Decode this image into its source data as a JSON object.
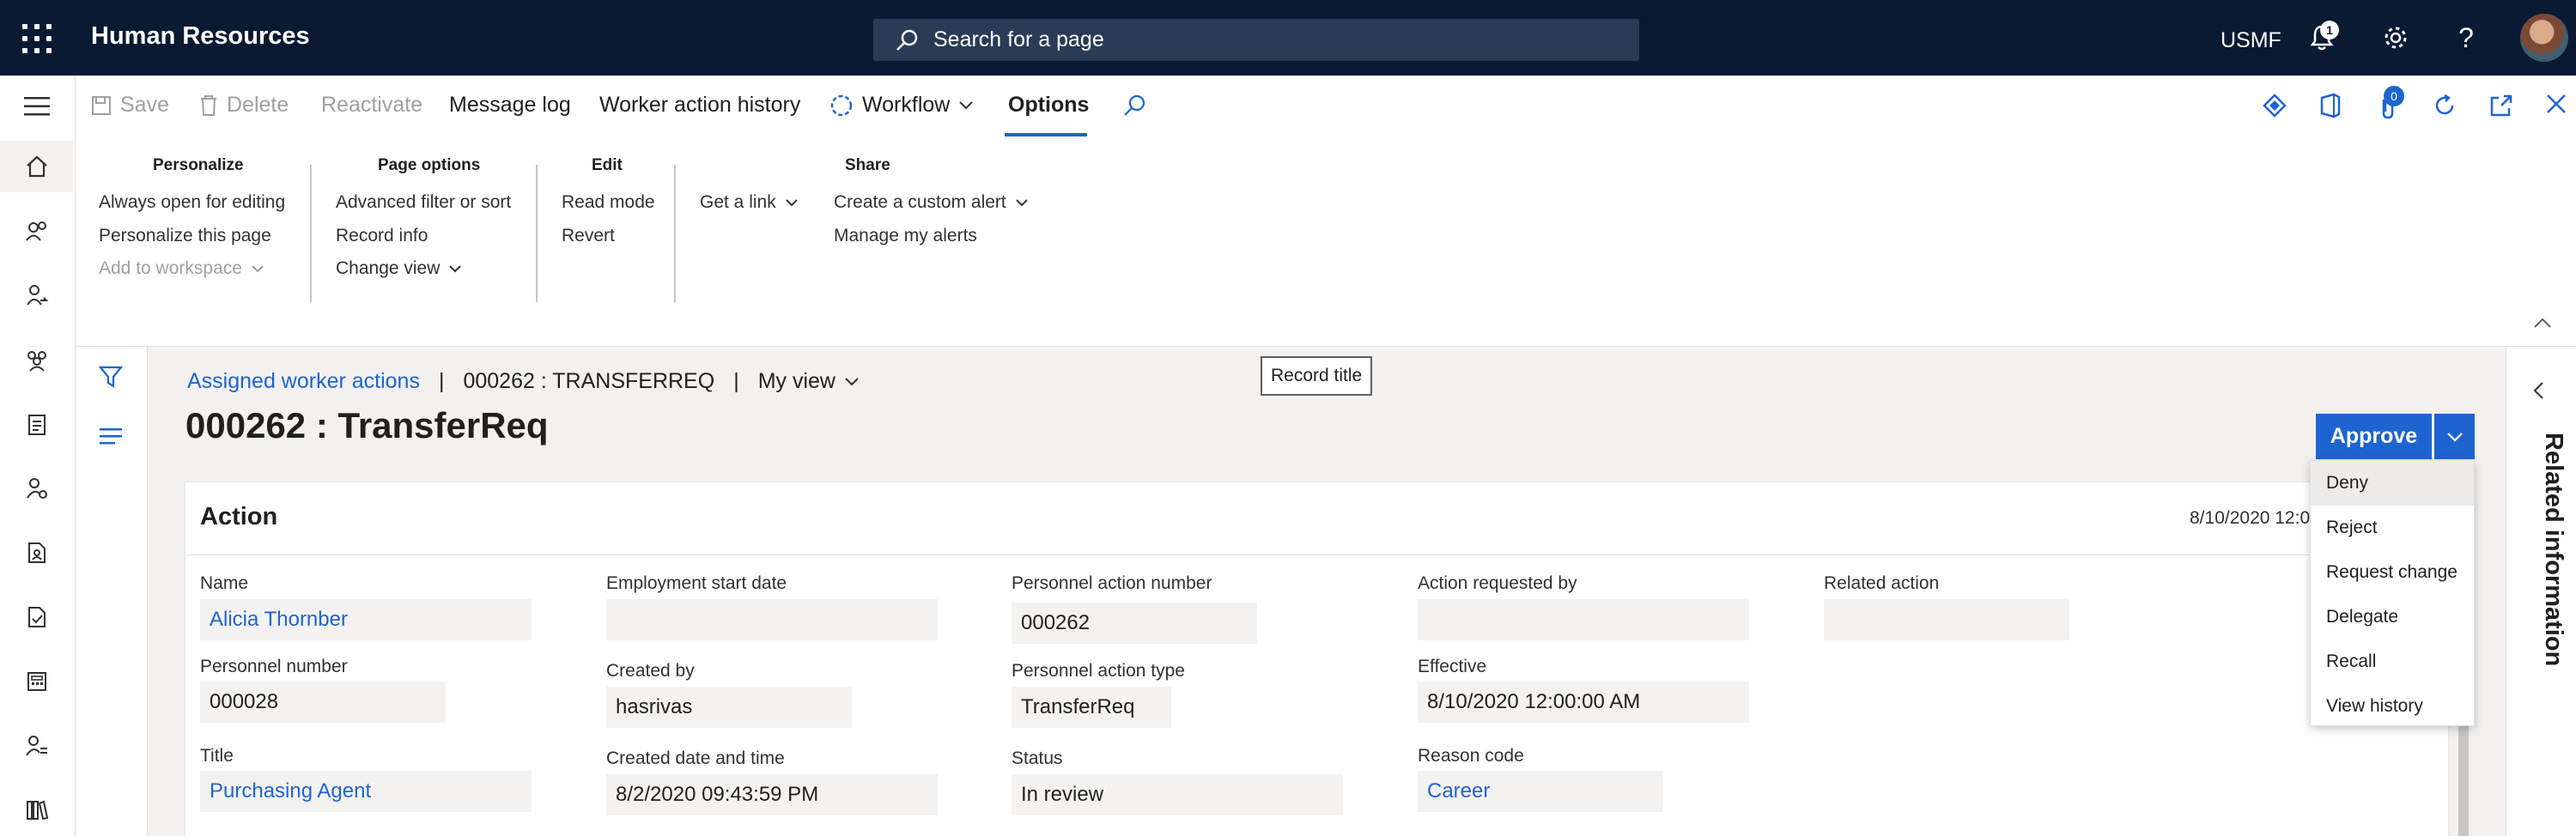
{
  "app": {
    "title": "Human Resources",
    "company": "USMF",
    "notifications": "1"
  },
  "search": {
    "placeholder": "Search for a page"
  },
  "action_pane": {
    "save": "Save",
    "delete": "Delete",
    "reactivate": "Reactivate",
    "message_log": "Message log",
    "worker_action_history": "Worker action history",
    "workflow": "Workflow",
    "options": "Options",
    "attachments_count": "0"
  },
  "ribbon": {
    "groups": [
      {
        "title": "Personalize",
        "items": [
          "Always open for editing",
          "Personalize this page",
          "Add to workspace"
        ]
      },
      {
        "title": "Page options",
        "items": [
          "Advanced filter or sort",
          "Record info",
          "Change view"
        ]
      },
      {
        "title": "Edit",
        "items": [
          "Read mode",
          "Revert"
        ]
      },
      {
        "title": "",
        "items": [
          "Get a link"
        ]
      },
      {
        "title": "Share",
        "items": [
          "Create a custom alert",
          "Manage my alerts"
        ]
      }
    ]
  },
  "breadcrumb": {
    "link": "Assigned worker actions",
    "sep": "|",
    "record": "000262 : TRANSFERREQ",
    "sep2": "|",
    "view": "My view"
  },
  "tooltip": "Record title",
  "page_title": "000262 : TransferReq",
  "approve": {
    "label": "Approve",
    "menu": [
      "Deny",
      "Reject",
      "Request change",
      "Delegate",
      "Recall",
      "View history"
    ]
  },
  "card": {
    "title": "Action",
    "date": "8/10/2020 12:0",
    "fields": {
      "name": {
        "label": "Name",
        "value": "Alicia Thornber"
      },
      "personnel_number": {
        "label": "Personnel number",
        "value": "000028"
      },
      "title": {
        "label": "Title",
        "value": "Purchasing Agent"
      },
      "employment_start": {
        "label": "Employment start date",
        "value": ""
      },
      "created_by": {
        "label": "Created by",
        "value": "hasrivas"
      },
      "created_datetime": {
        "label": "Created date and time",
        "value": "8/2/2020 09:43:59 PM"
      },
      "pa_number": {
        "label": "Personnel action number",
        "value": "000262"
      },
      "pa_type": {
        "label": "Personnel action type",
        "value": "TransferReq"
      },
      "status": {
        "label": "Status",
        "value": "In review"
      },
      "requested_by": {
        "label": "Action requested by",
        "value": ""
      },
      "effective": {
        "label": "Effective",
        "value": "8/10/2020 12:00:00 AM"
      },
      "reason_code": {
        "label": "Reason code",
        "value": "Career"
      },
      "related_action": {
        "label": "Related action",
        "value": ""
      }
    }
  },
  "related_information": "Related information"
}
